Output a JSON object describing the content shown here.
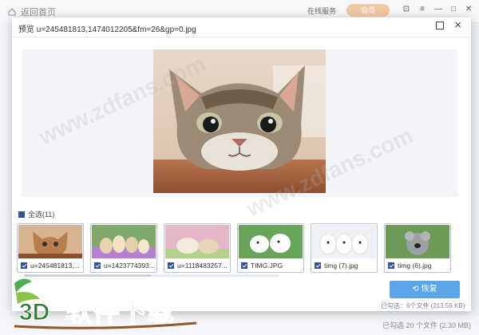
{
  "app": {
    "home_label": "返回首页",
    "service_label": "在线服务",
    "vip_label": "会员",
    "status_text": "已勾选 20 个文件 (2.30 MB)"
  },
  "modal": {
    "title": "预览 u=245481813,1474012205&fm=26&gp=0.jpg"
  },
  "select_all": {
    "label": "全选(11)"
  },
  "thumbnails": [
    {
      "name": "u=245481813,..."
    },
    {
      "name": "u=1423774393..."
    },
    {
      "name": "u=1118483257..."
    },
    {
      "name": "TIMG.JPG"
    },
    {
      "name": "timg (7).jpg"
    },
    {
      "name": "timg (6).jpg"
    }
  ],
  "restore_button": {
    "label": "恢复"
  },
  "selected_info": "已勾选：6个文件 (213.59 KB)",
  "watermark": {
    "brand": "3D软件下载",
    "site": "www.zdfans.com"
  },
  "colors": {
    "accent": "#5aa6e8",
    "vip": "#f0c9a4",
    "checkbox": "#2f5597"
  }
}
